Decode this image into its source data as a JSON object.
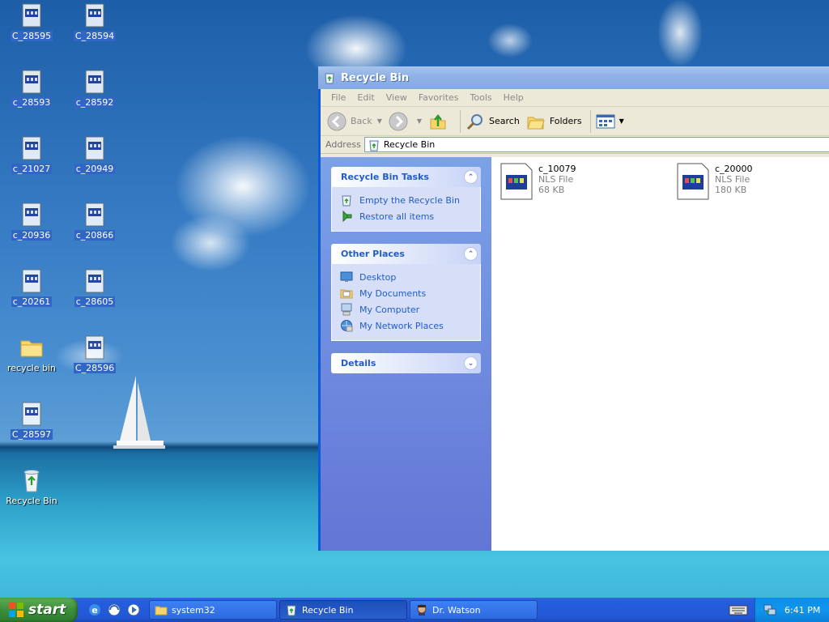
{
  "desktop": {
    "icons": [
      {
        "label": "C_28595",
        "icon": "nls-file-icon",
        "selected": true
      },
      {
        "label": "C_28594",
        "icon": "nls-file-icon",
        "selected": true
      },
      {
        "label": "c_28593",
        "icon": "nls-file-icon",
        "selected": true
      },
      {
        "label": "c_28592",
        "icon": "nls-file-icon",
        "selected": true
      },
      {
        "label": "c_21027",
        "icon": "nls-file-icon",
        "selected": true
      },
      {
        "label": "c_20949",
        "icon": "nls-file-icon",
        "selected": true
      },
      {
        "label": "c_20936",
        "icon": "nls-file-icon",
        "selected": true
      },
      {
        "label": "c_20866",
        "icon": "nls-file-icon",
        "selected": true
      },
      {
        "label": "c_20261",
        "icon": "nls-file-icon",
        "selected": true
      },
      {
        "label": "c_28605",
        "icon": "nls-file-icon",
        "selected": true
      },
      {
        "label": "recycle bin",
        "icon": "folder-icon",
        "selected": false
      },
      {
        "label": "C_28596",
        "icon": "nls-file-icon",
        "selected": true
      },
      {
        "label": "C_28597",
        "icon": "nls-file-icon",
        "selected": true
      },
      {
        "label": "Recycle Bin",
        "icon": "recycle-bin-icon",
        "selected": false
      }
    ]
  },
  "window": {
    "title": "Recycle Bin",
    "menu": [
      "File",
      "Edit",
      "View",
      "Favorites",
      "Tools",
      "Help"
    ],
    "toolbar": {
      "back_label": "Back",
      "search_label": "Search",
      "folders_label": "Folders"
    },
    "address": {
      "label": "Address",
      "value": "Recycle Bin"
    },
    "taskpane": {
      "tasks": {
        "title": "Recycle Bin Tasks",
        "links": [
          "Empty the Recycle Bin",
          "Restore all items"
        ]
      },
      "places": {
        "title": "Other Places",
        "links": [
          "Desktop",
          "My Documents",
          "My Computer",
          "My Network Places"
        ]
      },
      "details": {
        "title": "Details"
      }
    },
    "files": [
      {
        "name": "c_10079",
        "type": "NLS File",
        "size": "68 KB"
      },
      {
        "name": "c_20000",
        "type": "NLS File",
        "size": "180 KB"
      }
    ]
  },
  "taskbar": {
    "start_label": "start",
    "buttons": [
      "system32",
      "Recycle Bin",
      "Dr. Watson"
    ],
    "clock": "6:41 PM"
  },
  "colors": {
    "title_bar": "#90b2e6",
    "taskbar": "#245edc",
    "start_button": "#3c8f3b",
    "link_blue": "#215dc6",
    "selection": "#3166c5"
  }
}
